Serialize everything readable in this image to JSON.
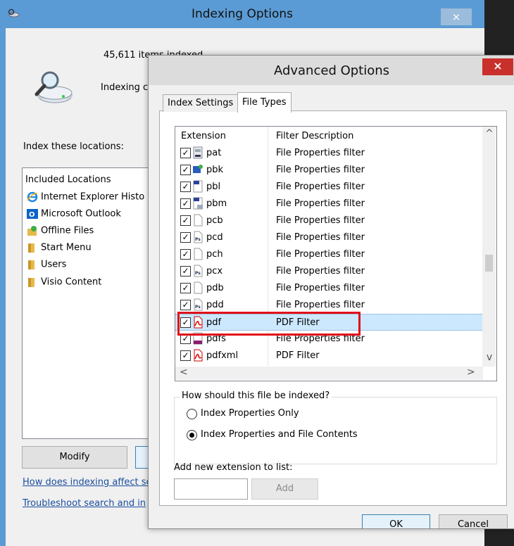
{
  "indexing_window": {
    "title": "Indexing Options",
    "close_glyph": "×",
    "items_indexed": "45,611 items indexed",
    "status": "Indexing c",
    "locations_label": "Index these locations:",
    "list_header": "Included Locations",
    "locations": [
      {
        "label": "Internet Explorer Histo",
        "icon": "internet-explorer-icon"
      },
      {
        "label": "Microsoft Outlook",
        "icon": "outlook-icon"
      },
      {
        "label": "Offline Files",
        "icon": "offline-files-icon"
      },
      {
        "label": "Start Menu",
        "icon": "folder-icon"
      },
      {
        "label": "Users",
        "icon": "folder-icon"
      },
      {
        "label": "Visio Content",
        "icon": "folder-icon"
      }
    ],
    "modify_label": "Modify",
    "link_indexing": "How does indexing affect se",
    "link_troubleshoot": "Troubleshoot search and in"
  },
  "advanced_dialog": {
    "title": "Advanced Options",
    "close_glyph": "×",
    "tabs": [
      {
        "label": "Index Settings",
        "active": false
      },
      {
        "label": "File Types",
        "active": true
      }
    ],
    "columns": [
      "Extension",
      "Filter Description"
    ],
    "rows": [
      {
        "ext": "pat",
        "desc": "File Properties filter",
        "checked": true,
        "icon": "pattern-file-icon",
        "selected": false
      },
      {
        "ext": "pbk",
        "desc": "File Properties filter",
        "checked": true,
        "icon": "phonebook-file-icon",
        "selected": false
      },
      {
        "ext": "pbl",
        "desc": "File Properties filter",
        "checked": true,
        "icon": "pbl-file-icon",
        "selected": false
      },
      {
        "ext": "pbm",
        "desc": "File Properties filter",
        "checked": true,
        "icon": "image-file-icon",
        "selected": false
      },
      {
        "ext": "pcb",
        "desc": "File Properties filter",
        "checked": true,
        "icon": "blank-file-icon",
        "selected": false
      },
      {
        "ext": "pcd",
        "desc": "File Properties filter",
        "checked": true,
        "icon": "photoshop-file-icon",
        "selected": false
      },
      {
        "ext": "pch",
        "desc": "File Properties filter",
        "checked": true,
        "icon": "blank-file-icon",
        "selected": false
      },
      {
        "ext": "pcx",
        "desc": "File Properties filter",
        "checked": true,
        "icon": "photoshop-file-icon",
        "selected": false
      },
      {
        "ext": "pdb",
        "desc": "File Properties filter",
        "checked": true,
        "icon": "blank-file-icon",
        "selected": false
      },
      {
        "ext": "pdd",
        "desc": "File Properties filter",
        "checked": true,
        "icon": "photoshop-file-icon",
        "selected": false
      },
      {
        "ext": "pdf",
        "desc": "PDF Filter",
        "checked": true,
        "icon": "pdf-file-icon",
        "selected": true
      },
      {
        "ext": "pdfs",
        "desc": "File Properties filter",
        "checked": true,
        "icon": "pdf-file-icon",
        "selected": false
      },
      {
        "ext": "pdfxml",
        "desc": "PDF Filter",
        "checked": true,
        "icon": "pdf-file-icon",
        "selected": false
      }
    ],
    "scroll_up_glyph": "^",
    "scroll_down_glyph": "v",
    "scroll_left_glyph": "<",
    "scroll_right_glyph": ">",
    "check_glyph": "✓",
    "index_question": "How should this file be indexed?",
    "option_props_only": "Index Properties Only",
    "option_props_contents": "Index Properties and File Contents",
    "selected_option": "Index Properties and File Contents",
    "add_ext_label": "Add new extension to list:",
    "add_ext_value": "",
    "add_label": "Add",
    "ok_label": "OK",
    "cancel_label": "Cancel"
  },
  "colors": {
    "titlebar_blue": "#5b9bd5",
    "close_red": "#c9302c",
    "highlight_red": "#e0101a",
    "selection_blue": "#cce8ff"
  }
}
